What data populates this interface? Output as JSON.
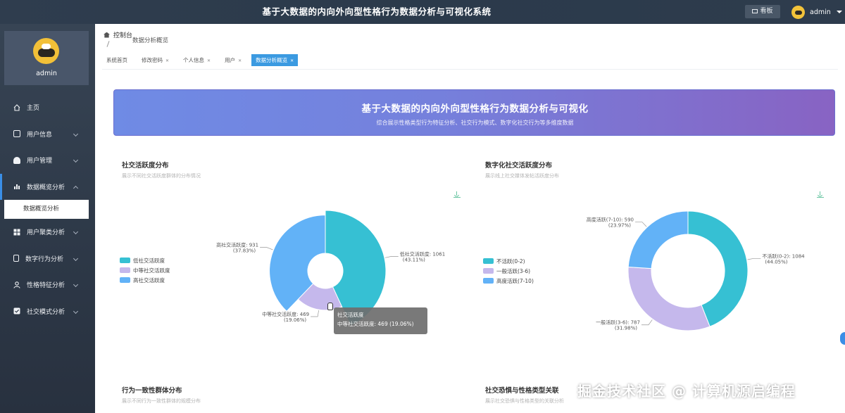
{
  "header": {
    "title": "基于大数据的内向外向型性格行为数据分析与可视化系统",
    "kanban_label": "看板",
    "username": "admin"
  },
  "sidebar": {
    "username": "admin",
    "items": [
      {
        "label": "主页",
        "icon": "home-icon"
      },
      {
        "label": "用户信息",
        "icon": "calendar-icon"
      },
      {
        "label": "用户管理",
        "icon": "user-icon"
      },
      {
        "label": "数据概览分析",
        "icon": "bar-chart-icon"
      },
      {
        "label": "用户聚类分析",
        "icon": "grid-icon"
      },
      {
        "label": "数字行为分析",
        "icon": "phone-icon"
      },
      {
        "label": "性格特征分析",
        "icon": "person-icon"
      },
      {
        "label": "社交模式分析",
        "icon": "checkbox-icon"
      }
    ],
    "active_sub": "数据概览分析"
  },
  "breadcrumb": {
    "root": "控制台",
    "current": "数据分析概览"
  },
  "tabs": [
    {
      "label": "系统首页",
      "closable": false
    },
    {
      "label": "修改密码",
      "closable": true
    },
    {
      "label": "个人信息",
      "closable": true
    },
    {
      "label": "用户",
      "closable": true
    },
    {
      "label": "数据分析概览",
      "closable": true,
      "active": true
    }
  ],
  "banner": {
    "title": "基于大数据的内向外向型性格行为数据分析与可视化",
    "subtitle": "综合展示性格类型行为特征分析、社交行为模式、数字化社交行为等多维度数据"
  },
  "cards": {
    "social": {
      "title": "社交活跃度分布",
      "subtitle": "展示不同社交活跃度群体的分布情况"
    },
    "digital": {
      "title": "数字化社交活跃度分布",
      "subtitle": "展示线上社交媒体发帖活跃度分布"
    },
    "behavior": {
      "title": "行为一致性群体分布",
      "subtitle": "展示不同行为一致性群体的规模分布"
    },
    "fear": {
      "title": "社交恐惧与性格类型关联",
      "subtitle": "展示社交恐惧与性格类型的关联分析"
    }
  },
  "tooltip": {
    "title": "社交活跃度",
    "line": "中等社交活跃度: 469 (19.06%)"
  },
  "watermark": "掘金技术社区 @ 计算机源启编程",
  "colors": {
    "cyan": "#36c0d3",
    "lavender": "#c5b8ec",
    "blue": "#62b2f7",
    "accent": "#3b9ae1"
  },
  "chart_data": [
    {
      "type": "pie",
      "variant": "rose",
      "series_name": "社交活跃度",
      "categories": [
        "低社交活跃度",
        "中等社交活跃度",
        "高社交活跃度"
      ],
      "values": [
        1061,
        469,
        931
      ],
      "percents": [
        43.11,
        19.06,
        37.83
      ],
      "labels": [
        "低社交活跃度: 1061",
        "中等社交活跃度: 469",
        "高社交活跃度: 931"
      ],
      "percent_labels": [
        "(43.11%)",
        "(19.06%)",
        "(37.83%)"
      ],
      "colors": [
        "#36c0d3",
        "#c5b8ec",
        "#62b2f7"
      ],
      "legend": "left"
    },
    {
      "type": "pie",
      "variant": "donut",
      "categories": [
        "不活跃(0-2)",
        "一般活跃(3-6)",
        "高度活跃(7-10)"
      ],
      "values": [
        1084,
        787,
        590
      ],
      "percents": [
        44.05,
        31.98,
        23.97
      ],
      "labels": [
        "不活跃(0-2): 1084",
        "一般活跃(3-6): 787",
        "高度活跃(7-10): 590"
      ],
      "percent_labels": [
        "(44.05%)",
        "(31.98%)",
        "(23.97%)"
      ],
      "colors": [
        "#36c0d3",
        "#c5b8ec",
        "#62b2f7"
      ],
      "legend": "left"
    }
  ]
}
